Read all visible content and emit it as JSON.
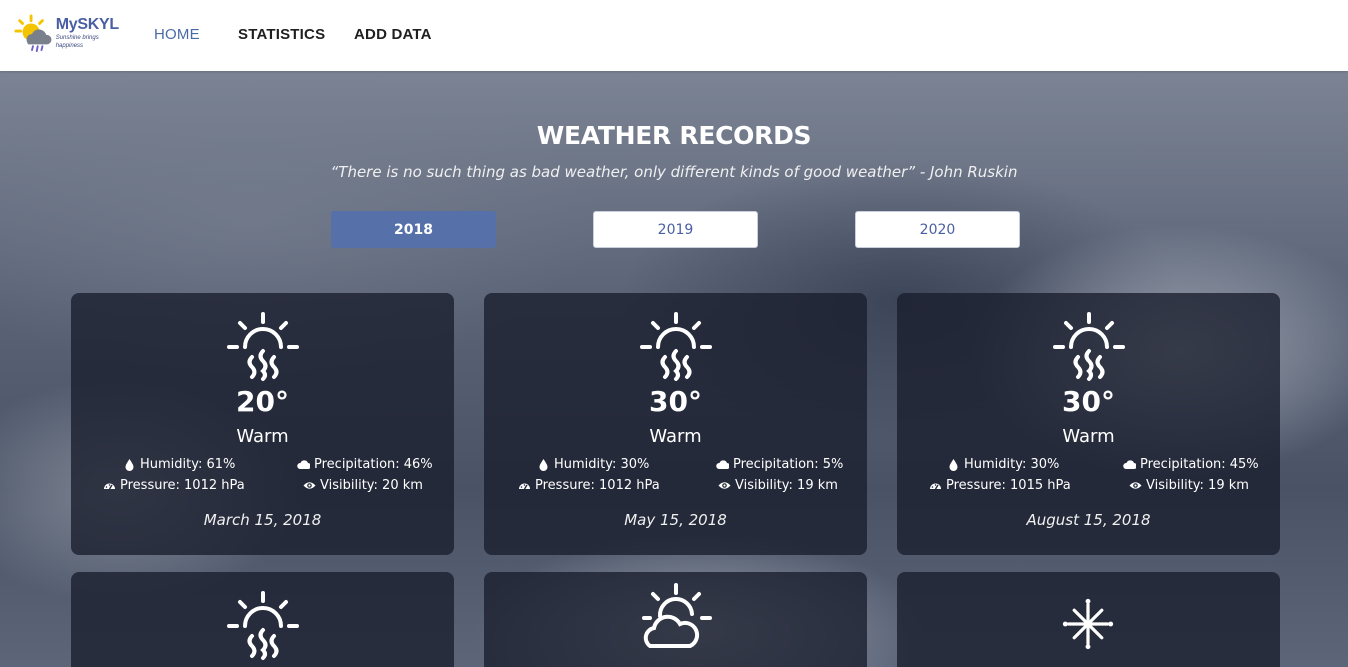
{
  "brand": {
    "name": "MySKYL",
    "tagline": "Sunshine brings happiness"
  },
  "nav": {
    "home": "HOME",
    "statistics": "STATISTICS",
    "add_data": "ADD DATA"
  },
  "hero": {
    "title": "WEATHER RECORDS",
    "quote": "“There is no such thing as bad weather, only different kinds of good weather” - John Ruskin"
  },
  "years": [
    "2018",
    "2019",
    "2020"
  ],
  "active_year": "2018",
  "colors": {
    "accent": "#5670a9",
    "card_bg": "rgba(25,30,45,.78)"
  },
  "records": [
    {
      "icon": "sun-heat-icon",
      "temp": "20°",
      "condition": "Warm",
      "humidity": "Humidity: 61%",
      "precipitation": "Precipitation: 46%",
      "pressure": "Pressure: 1012 hPa",
      "visibility": "Visibility: 20 km",
      "date": "March 15, 2018"
    },
    {
      "icon": "sun-heat-icon",
      "temp": "30°",
      "condition": "Warm",
      "humidity": "Humidity: 30%",
      "precipitation": "Precipitation: 5%",
      "pressure": "Pressure: 1012 hPa",
      "visibility": "Visibility: 19 km",
      "date": "May 15, 2018"
    },
    {
      "icon": "sun-heat-icon",
      "temp": "30°",
      "condition": "Warm",
      "humidity": "Humidity: 30%",
      "precipitation": "Precipitation: 45%",
      "pressure": "Pressure: 1015 hPa",
      "visibility": "Visibility: 19 km",
      "date": "August 15, 2018"
    },
    {
      "icon": "sun-heat-icon"
    },
    {
      "icon": "sun-cloud-icon"
    },
    {
      "icon": "snowflake-icon"
    }
  ]
}
